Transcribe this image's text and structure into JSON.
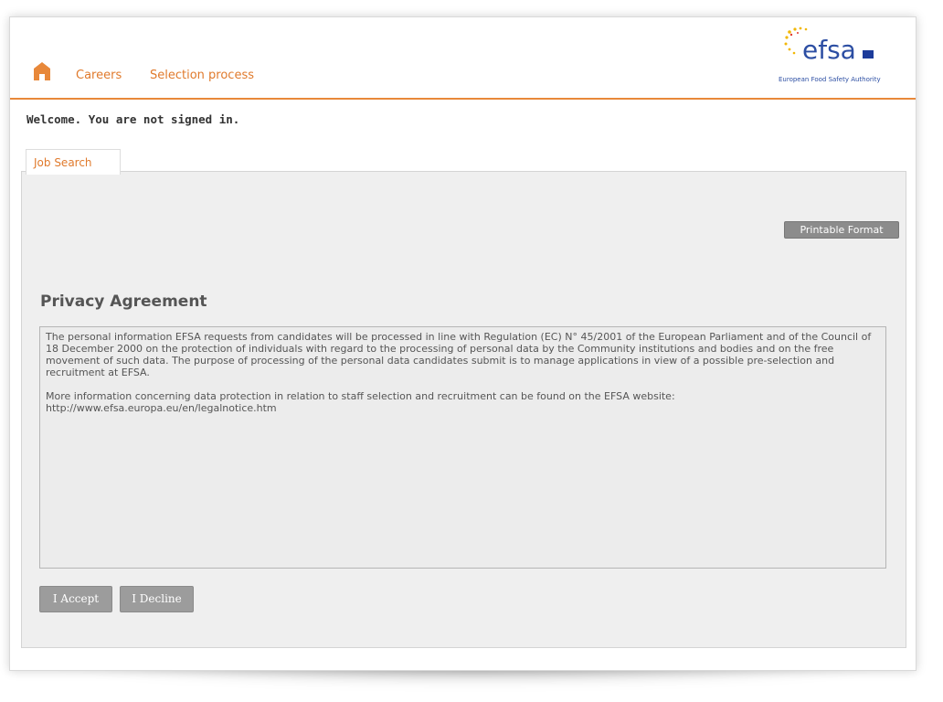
{
  "header": {
    "nav": {
      "careers_label": "Careers",
      "selection_label": "Selection process"
    },
    "logo": {
      "wordmark": "efsa",
      "subtitle": "European Food Safety Authority"
    }
  },
  "status": {
    "welcome_text": "Welcome. You are not signed in."
  },
  "tabs": [
    {
      "label": "Job Search"
    }
  ],
  "panel": {
    "printable_label": "Printable Format",
    "title": "Privacy Agreement",
    "agreement": {
      "paragraph_1": "The personal information EFSA requests from candidates will be processed in line with Regulation (EC) N° 45/2001 of the European Parliament and of the Council of 18 December 2000 on the protection of individuals with regard to the processing of personal data by the Community institutions and bodies and on the free movement of such data. The purpose of processing of the personal data candidates submit is to manage applications in view of a possible pre-selection and recruitment at EFSA.",
      "paragraph_2": "More information concerning data protection in relation to staff selection and recruitment can be found on the EFSA website:",
      "url": "http://www.efsa.europa.eu/en/legalnotice.htm"
    },
    "buttons": {
      "accept_label": "I Accept",
      "decline_label": "I Decline"
    }
  },
  "colors": {
    "accent_orange": "#e07a2c",
    "header_rule": "#e8883a",
    "logo_blue": "#2c4ea3",
    "button_gray": "#9c9c9c"
  },
  "icons": {
    "home": "home-icon",
    "stars": "eu-stars-icon",
    "flag": "eu-flag-icon"
  }
}
